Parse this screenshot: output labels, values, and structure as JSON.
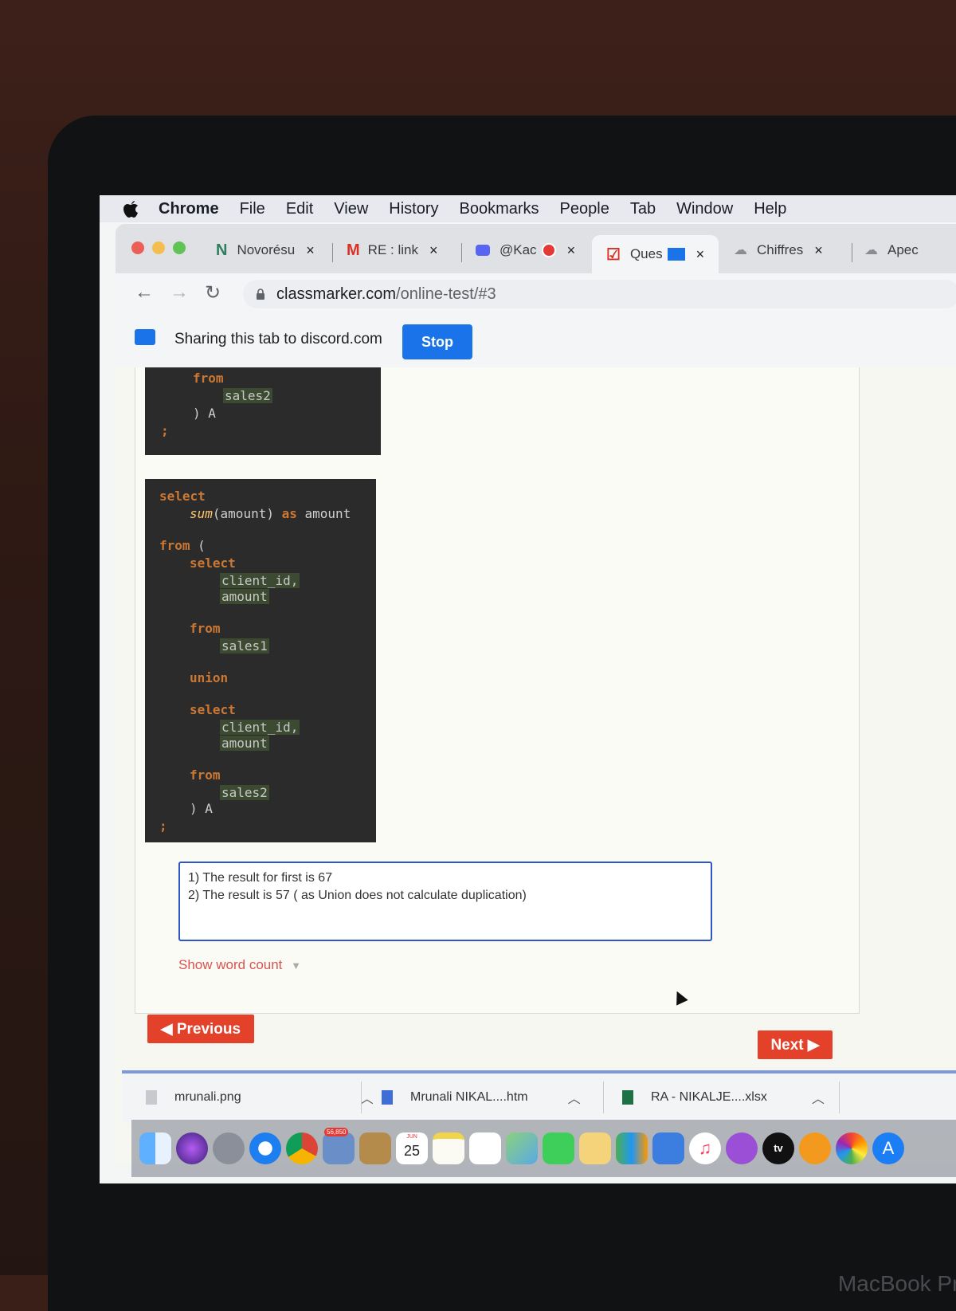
{
  "menubar": {
    "items": [
      "Chrome",
      "File",
      "Edit",
      "View",
      "History",
      "Bookmarks",
      "People",
      "Tab",
      "Window",
      "Help"
    ]
  },
  "tabs": [
    {
      "label": "Novorésu",
      "close": "×"
    },
    {
      "label": "RE : link",
      "close": "×"
    },
    {
      "label": "@Kac",
      "close": "×"
    },
    {
      "label": "Ques",
      "close": "×"
    },
    {
      "label": "Chiffres",
      "close": "×"
    },
    {
      "label": "Apec",
      "close": ""
    }
  ],
  "address": {
    "host": "classmarker.com",
    "path": "/online-test/#3"
  },
  "sharing": {
    "text": "Sharing this tab to discord.com",
    "stop_label": "Stop"
  },
  "code_top": {
    "lines": [
      "from",
      "sales2",
      ") A",
      ";"
    ]
  },
  "code_main": {
    "select1": "select",
    "sum": "sum",
    "sum_args": "(amount)",
    "as": "as",
    "alias": "amount",
    "from_open_kw": "from",
    "from_open_paren": "(",
    "select2": "select",
    "col1": "client_id,",
    "col2": "amount",
    "from1": "from",
    "tbl1": "sales1",
    "union": "union",
    "select3": "select",
    "col3": "client_id,",
    "col4": "amount",
    "from2": "from",
    "tbl2": "sales2",
    "close": ") A",
    "semicolon": ";"
  },
  "answer": {
    "line1": "1) The result for first is 67",
    "line2": "2) The result is 57 ( as Union does not calculate duplication)"
  },
  "word_count_label": "Show word count",
  "buttons": {
    "previous": "Previous",
    "next": "Next"
  },
  "downloads": [
    {
      "name": "mrunali.png"
    },
    {
      "name": "Mrunali NIKAL....htm"
    },
    {
      "name": "RA - NIKALJE....xlsx"
    }
  ],
  "dock": {
    "mail_badge": "56,850",
    "calendar_month": "JUN",
    "calendar_day": "25",
    "tv_label": "tv"
  },
  "laptop_brand": "MacBook Pro",
  "colors": {
    "accent": "#1a73e8",
    "danger": "#e4412a",
    "code_bg": "#2b2b2b"
  }
}
